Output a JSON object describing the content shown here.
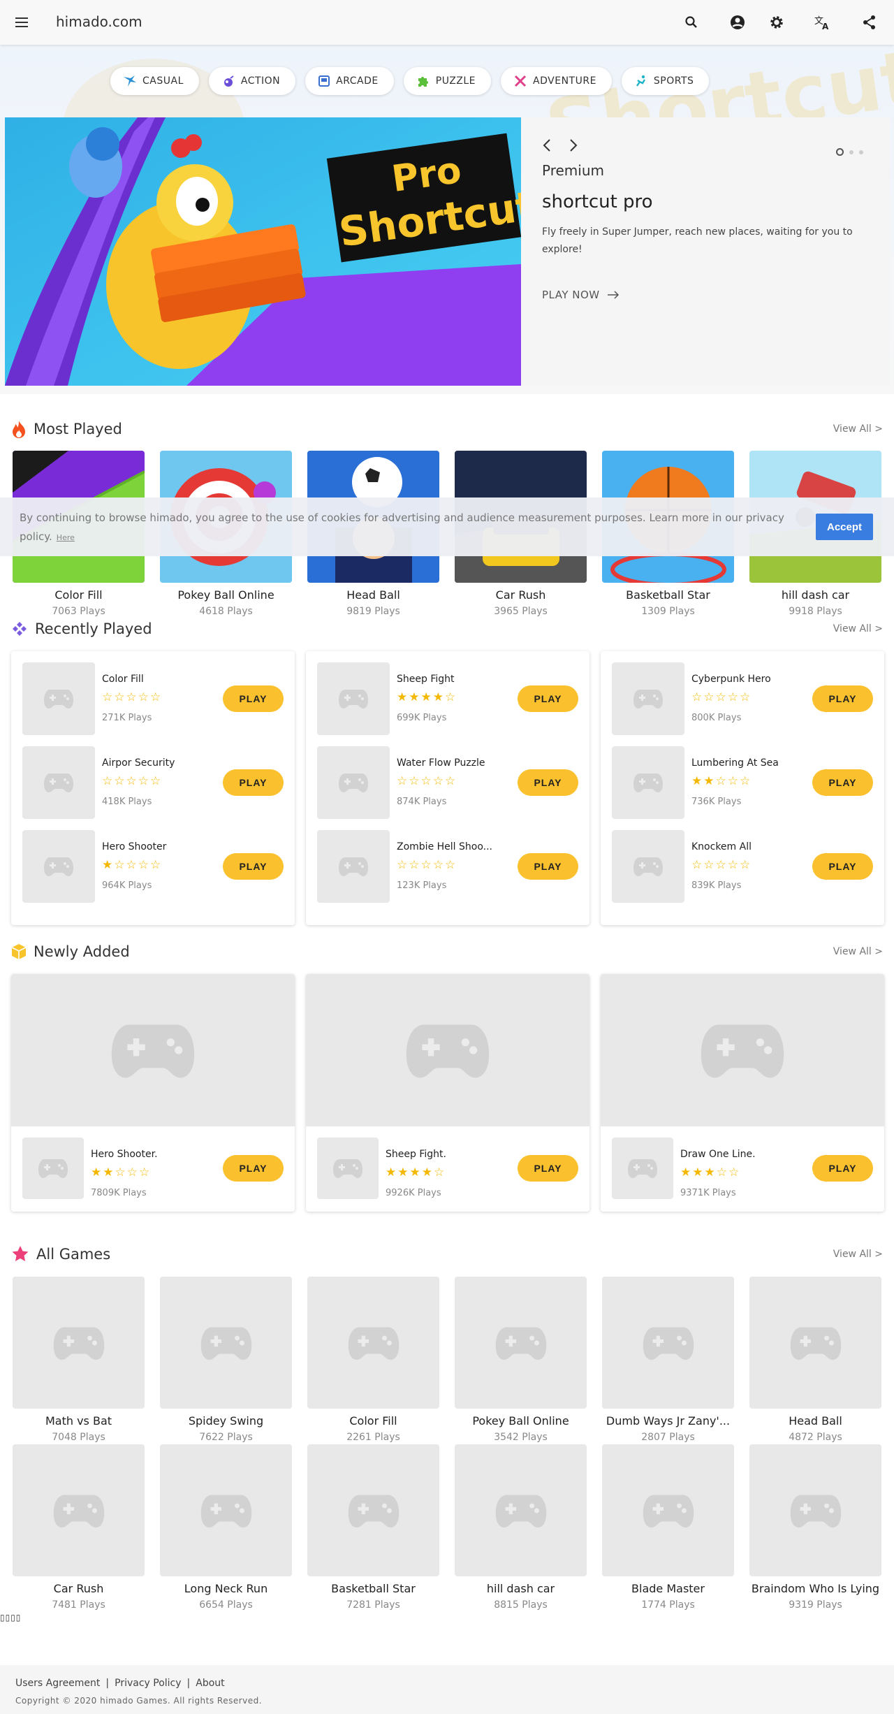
{
  "header": {
    "site_title": "himado.com"
  },
  "categories": [
    {
      "label": "CASUAL",
      "icon": "casual-icon",
      "color": "#2b8fd6"
    },
    {
      "label": "ACTION",
      "icon": "action-icon",
      "color": "#6b4fd8"
    },
    {
      "label": "ARCADE",
      "icon": "arcade-icon",
      "color": "#3a6fd0"
    },
    {
      "label": "PUZZLE",
      "icon": "puzzle-icon",
      "color": "#5cbf3a"
    },
    {
      "label": "ADVENTURE",
      "icon": "adventure-icon",
      "color": "#e0408a"
    },
    {
      "label": "SPORTS",
      "icon": "sports-icon",
      "color": "#1fb5c9"
    }
  ],
  "hero": {
    "banner_text_1": "Pro",
    "banner_text_2": "Shortcut",
    "category": "Premium",
    "title": "shortcut pro",
    "description": "Fly freely in Super Jumper, reach new places, waiting for you to explore!",
    "cta": "PLAY NOW"
  },
  "most_played": {
    "title": "Most Played",
    "view_all": "View All >",
    "items": [
      {
        "name": "Color Fill",
        "plays": "7063 Plays"
      },
      {
        "name": "Pokey Ball Online",
        "plays": "4618 Plays"
      },
      {
        "name": "Head Ball",
        "plays": "9819 Plays"
      },
      {
        "name": "Car Rush",
        "plays": "3965 Plays"
      },
      {
        "name": "Basketball Star",
        "plays": "1309 Plays"
      },
      {
        "name": "hill dash car",
        "plays": "9918 Plays"
      }
    ]
  },
  "cookie": {
    "text": "By continuing to browse himado, you agree to the use of cookies for advertising and audience measurement purposes. Learn more in our privacy policy.",
    "here": "Here",
    "accept": "Accept"
  },
  "recently_played": {
    "title": "Recently Played",
    "view_all": "View All >",
    "play_label": "PLAY",
    "columns": [
      [
        {
          "name": "Color Fill",
          "stars": "☆☆☆☆☆",
          "rating": 0,
          "plays": "271K Plays"
        },
        {
          "name": "Airpor Security",
          "stars": "☆☆☆☆☆",
          "rating": 0,
          "plays": "418K Plays"
        },
        {
          "name": "Hero Shooter",
          "stars": "★☆☆☆☆",
          "rating": 1,
          "plays": "964K Plays"
        }
      ],
      [
        {
          "name": "Sheep Fight",
          "stars": "★★★★☆",
          "rating": 4,
          "plays": "699K Plays"
        },
        {
          "name": "Water Flow Puzzle",
          "stars": "☆☆☆☆☆",
          "rating": 0,
          "plays": "874K Plays"
        },
        {
          "name": "Zombie Hell Shoo...",
          "stars": "☆☆☆☆☆",
          "rating": 0,
          "plays": "123K Plays"
        }
      ],
      [
        {
          "name": "Cyberpunk Hero",
          "stars": "☆☆☆☆☆",
          "rating": 0,
          "plays": "800K Plays"
        },
        {
          "name": "Lumbering At Sea",
          "stars": "★★☆☆☆",
          "rating": 2,
          "plays": "736K Plays"
        },
        {
          "name": "Knockem All",
          "stars": "☆☆☆☆☆",
          "rating": 0,
          "plays": "839K Plays"
        }
      ]
    ]
  },
  "newly_added": {
    "title": "Newly Added",
    "view_all": "View All >",
    "play_label": "PLAY",
    "items": [
      {
        "name": "Hero Shooter.",
        "stars": "★★☆☆☆",
        "rating": 2,
        "plays": "7809K Plays"
      },
      {
        "name": "Sheep Fight.",
        "stars": "★★★★☆",
        "rating": 4,
        "plays": "9926K Plays"
      },
      {
        "name": "Draw One Line.",
        "stars": "★★★☆☆",
        "rating": 3,
        "plays": "9371K Plays"
      }
    ]
  },
  "all_games": {
    "title": "All Games",
    "view_all": "View All >",
    "items": [
      {
        "name": "Math vs Bat",
        "plays": "7048 Plays"
      },
      {
        "name": "Spidey Swing",
        "plays": "7622 Plays"
      },
      {
        "name": "Color Fill",
        "plays": "2261 Plays"
      },
      {
        "name": "Pokey Ball Online",
        "plays": "3542 Plays"
      },
      {
        "name": "Dumb Ways Jr Zany'...",
        "plays": "2807 Plays"
      },
      {
        "name": "Head Ball",
        "plays": "4872 Plays"
      },
      {
        "name": "Car Rush",
        "plays": "7481 Plays"
      },
      {
        "name": "Long Neck Run",
        "plays": "6654 Plays"
      },
      {
        "name": "Basketball Star",
        "plays": "7281 Plays"
      },
      {
        "name": "hill dash car",
        "plays": "8815 Plays"
      },
      {
        "name": "Blade Master",
        "plays": "1774 Plays"
      },
      {
        "name": "Braindom Who Is Lying",
        "plays": "9319 Plays"
      }
    ]
  },
  "stray_glyphs": "▯▯▯▯",
  "footer": {
    "links": [
      "Users Agreement",
      "Privacy Policy",
      "About"
    ],
    "separator": "|",
    "copyright": "Copyright © 2020 himado Games. All rights Reserved."
  },
  "colors": {
    "accent": "#fbc02d",
    "accept_button": "#3a7de0",
    "star": "#f5b800"
  }
}
